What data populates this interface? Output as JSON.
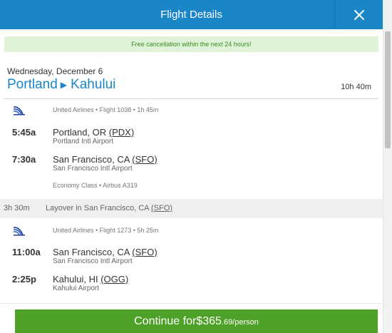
{
  "header": {
    "title": "Flight Details"
  },
  "notice": "Free cancellation within the next 24 hours!",
  "trip": {
    "date": "Wednesday, December 6",
    "origin": "Portland",
    "destination": "Kahului",
    "duration": "10h 40m"
  },
  "segments": [
    {
      "meta": "United Airlines • Flight 1038 • 1h 45m",
      "depart": {
        "time": "5:45a",
        "city": "Portland, OR",
        "code": "(PDX)",
        "airport": "Portland Intl Airport"
      },
      "arrive": {
        "time": "7:30a",
        "city": "San Francisco, CA",
        "code": "(SFO)",
        "airport": "San Francisco Intl Airport"
      },
      "cabin": "Economy Class • Airbus A319"
    },
    {
      "meta": "United Airlines • Flight 1273 • 5h 25m",
      "depart": {
        "time": "11:00a",
        "city": "San Francisco, CA",
        "code": "(SFO)",
        "airport": "San Francisco Intl Airport"
      },
      "arrive": {
        "time": "2:25p",
        "city": "Kahului, HI",
        "code": "(OGG)",
        "airport": "Kahului Airport"
      }
    }
  ],
  "layover": {
    "duration": "3h 30m",
    "text": "Layover in San Francisco, CA",
    "code": "(SFO)"
  },
  "footer": {
    "label": "Continue for ",
    "price_main": "$365",
    "price_cents": ".69/person"
  },
  "colors": {
    "brand": "#1a86c8",
    "cta": "#4ea128",
    "notice_bg": "#dff3d8",
    "notice_text": "#3a8d1e"
  },
  "icons": {
    "close": "close-icon",
    "airline": "united-airlines-logo"
  }
}
